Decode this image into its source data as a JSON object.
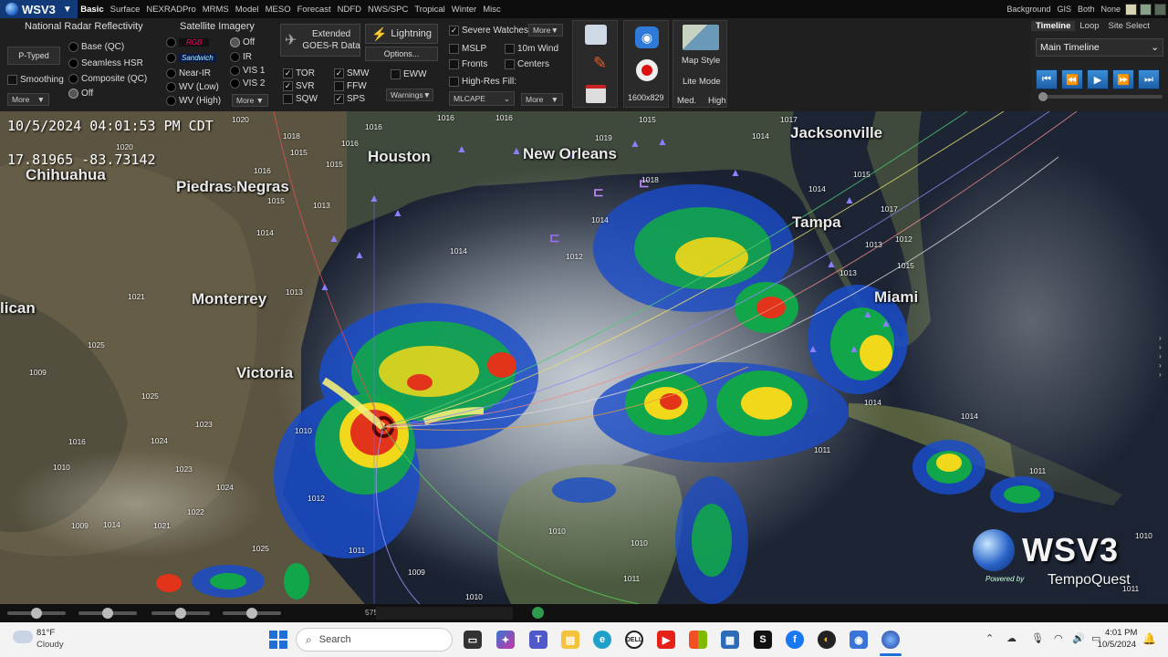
{
  "app": {
    "name": "WSV3"
  },
  "menu": [
    "Basic",
    "Surface",
    "NEXRADPro",
    "MRMS",
    "Model",
    "MESO",
    "Forecast",
    "NDFD",
    "NWS/SPC",
    "Tropical",
    "Winter",
    "Misc"
  ],
  "background": {
    "labels": [
      "Background",
      "GIS",
      "Both",
      "None"
    ],
    "swatches": [
      "#d4d4b4",
      "#8aa28a",
      "#5a6a5a"
    ]
  },
  "radar": {
    "title": "National Radar Reflectivity",
    "ptyped": "P-Typed",
    "smoothing": "Smoothing",
    "more": "More",
    "options": [
      "Base (QC)",
      "Seamless HSR",
      "Composite (QC)",
      "Off"
    ]
  },
  "satellite": {
    "title": "Satellite Imagery",
    "rgb": "RGB",
    "sandwich": "Sandwich",
    "col1": [
      "Near-IR",
      "WV (Low)",
      "WV (High)"
    ],
    "col2": [
      "Off",
      "IR",
      "VIS 1",
      "VIS 2"
    ],
    "more": "More"
  },
  "goes": {
    "line1": "Extended",
    "line2": "GOES-R Data"
  },
  "lightning": {
    "label": "Lightning",
    "options": "Options..."
  },
  "warnings": {
    "col1": [
      "TOR",
      "SVR",
      "SQW"
    ],
    "col2": [
      "SMW",
      "FFW",
      "SPS"
    ],
    "eww": "EWW",
    "dropdown": "Warnings"
  },
  "severe": {
    "watches": "Severe Watches",
    "more": "More",
    "mslp": "MSLP",
    "wind": "10m Wind",
    "fronts": "Fronts",
    "centers": "Centers",
    "hires": "High-Res Fill:",
    "fill": "MLCAPE",
    "more2": "More"
  },
  "tools": {
    "resolution": "1600x829"
  },
  "mapstyle": {
    "label": "Map Style",
    "lite": "Lite Mode",
    "med": "Med.",
    "high": "High"
  },
  "timeline": {
    "tabs": [
      "Timeline",
      "Loop",
      "Site Select"
    ],
    "selected": "Main Timeline"
  },
  "overlay": {
    "datetime": "10/5/2024  04:01:53  PM  CDT",
    "coords": "17.81965  -83.73142"
  },
  "cities": [
    {
      "name": "Chihuahua"
    },
    {
      "name": "Houston"
    },
    {
      "name": "New Orleans"
    },
    {
      "name": "Jacksonville"
    },
    {
      "name": "Piedras Negras"
    },
    {
      "name": "Tampa"
    },
    {
      "name": "Monterrey"
    },
    {
      "name": "Miami"
    },
    {
      "name": "Victoria"
    },
    {
      "name": "lican"
    }
  ],
  "isobars": [
    "1020",
    "1018",
    "1016",
    "1020",
    "1016",
    "1015",
    "1017",
    "1016",
    "1015",
    "1013",
    "1015",
    "1014",
    "1017",
    "1014",
    "1015",
    "1019",
    "1014",
    "1018",
    "1012",
    "1014",
    "1015",
    "1013",
    "1017",
    "1015",
    "1012",
    "1013",
    "1014",
    "1021",
    "1025",
    "1009",
    "1025",
    "1023",
    "1016",
    "1024",
    "1023",
    "1024",
    "1022",
    "1021",
    "1009",
    "1014",
    "1025",
    "1012",
    "1011",
    "1010",
    "1010",
    "1011",
    "1013",
    "1014",
    "1011",
    "1010",
    "1009",
    "1011",
    "1011",
    "1010",
    "1014",
    "1016",
    "1016",
    "1010",
    "1010"
  ],
  "watermark": {
    "brand": "WSV3",
    "powered": "Powered by",
    "company": "TempoQuest"
  },
  "bottombar": {
    "value": "575"
  },
  "weather": {
    "temp": "81°F",
    "condition": "Cloudy"
  },
  "taskbar": {
    "search": "Search",
    "time": "4:01 PM",
    "date": "10/5/2024"
  }
}
